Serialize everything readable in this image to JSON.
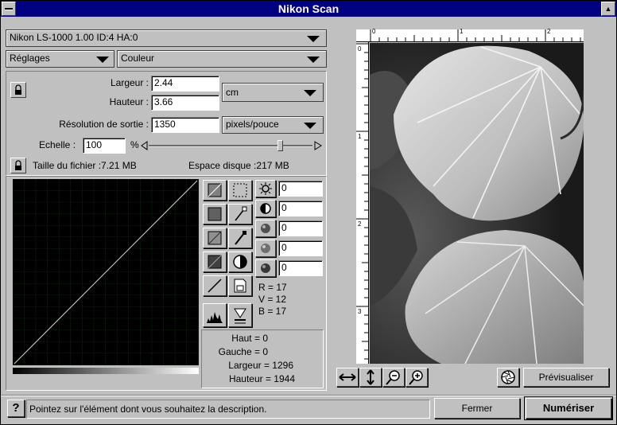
{
  "window": {
    "title": "Nikon Scan"
  },
  "device": {
    "label": "Nikon  LS-1000      1.00 ID:4 HA:0"
  },
  "settings": {
    "label": "Réglages",
    "mode": "Couleur"
  },
  "size": {
    "width_label": "Largeur :",
    "width_value": "2.44",
    "height_label": "Hauteur :",
    "height_value": "3.66",
    "unit": "cm",
    "resolution_label": "Résolution de sortie :",
    "resolution_value": "1350",
    "resolution_unit": "pixels/pouce",
    "scale_label": "Echelle :",
    "scale_value": "100",
    "scale_unit": "%",
    "scale_level_percent": 80,
    "filesize_label": "Taille du fichier :7.21 MB",
    "diskspace_label": "Espace disque :217 MB"
  },
  "adjustments": {
    "brightness": "0",
    "contrast": "0",
    "red": "0",
    "green": "0",
    "blue": "0"
  },
  "rgb": {
    "r": "R = 17",
    "v": "V = 12",
    "b": "B = 17"
  },
  "crop": {
    "top": "Haut = 0",
    "left": "Gauche = 0",
    "width": "Largeur = 1296",
    "height": "Hauteur = 1944"
  },
  "ruler": {
    "h_labels": [
      "0",
      "1",
      "2"
    ],
    "v_labels": [
      "0",
      "1",
      "2",
      "3"
    ]
  },
  "preview": {
    "button": "Prévisualiser"
  },
  "status": {
    "text": "Pointez sur l'élément dont vous souhaitez la description.",
    "help_icon": "?"
  },
  "buttons": {
    "close": "Fermer",
    "scan": "Numériser"
  }
}
